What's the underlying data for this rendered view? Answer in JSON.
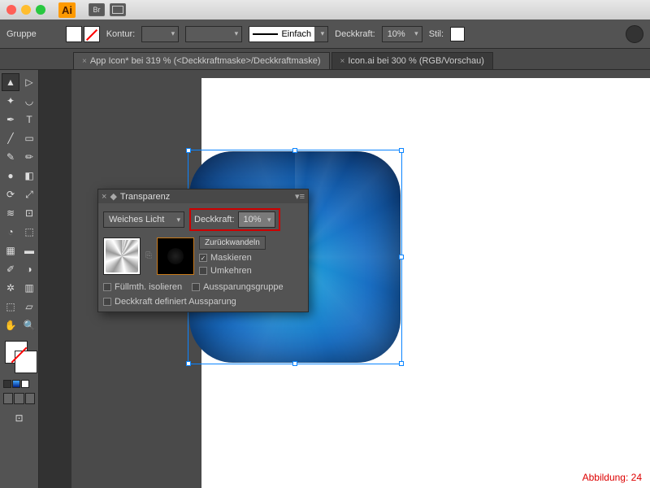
{
  "titlebar": {
    "app_badge": "Ai",
    "br_badge": "Br"
  },
  "control_bar": {
    "group_label": "Gruppe",
    "stroke_label": "Kontur:",
    "stroke_style": "Einfach",
    "opacity_label": "Deckkraft:",
    "opacity_value": "10%",
    "style_label": "Stil:"
  },
  "tabs": {
    "t1": "App Icon* bei 319 % (<Deckkraftmaske>/Deckkraftmaske)",
    "t2": "Icon.ai bei 300 % (RGB/Vorschau)"
  },
  "panel": {
    "title": "Transparenz",
    "blend_mode": "Weiches Licht",
    "opacity_label": "Deckkraft:",
    "opacity_value": "10%",
    "revert_btn": "Zurückwandeln",
    "mask_chk": "Maskieren",
    "invert_chk": "Umkehren",
    "isolate_chk": "Füllmth. isolieren",
    "knockout_chk": "Aussparungsgruppe",
    "defines_knockout": "Deckkraft definiert Aussparung"
  },
  "caption": "Abbildung: 24"
}
